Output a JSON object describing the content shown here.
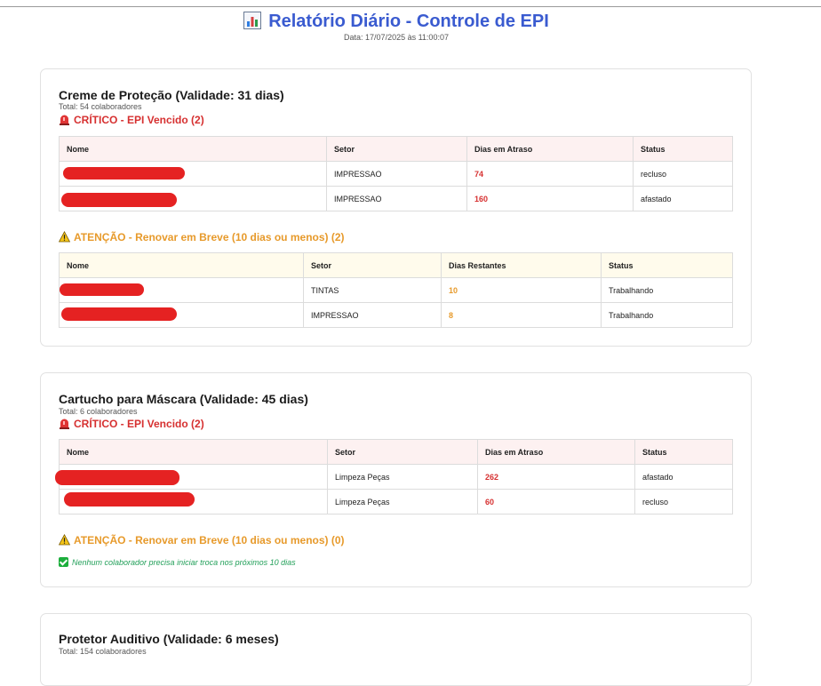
{
  "report": {
    "title": "Relatório Diário - Controle de EPI",
    "date": "Data: 17/07/2025 às 11:00:07",
    "icon": "bar-chart-icon"
  },
  "sections": [
    {
      "title": "Creme de Proteção (Validade: 31 dias)",
      "total": "Total: 54 colaboradores",
      "critical": {
        "label": "CRÍTICO - EPI Vencido (2)",
        "icon": "siren-icon",
        "headers": [
          "Nome",
          "Setor",
          "Dias em Atraso",
          "Status"
        ],
        "rows": [
          {
            "nome": "",
            "setor": "IMPRESSAO",
            "dias": "74",
            "status": "recluso"
          },
          {
            "nome": "",
            "setor": "IMPRESSAO",
            "dias": "160",
            "status": "afastado"
          }
        ]
      },
      "warning": {
        "label": "ATENÇÃO - Renovar em Breve (10 dias ou menos) (2)",
        "icon": "warning-icon",
        "headers": [
          "Nome",
          "Setor",
          "Dias Restantes",
          "Status"
        ],
        "rows": [
          {
            "nome": "",
            "setor": "TINTAS",
            "dias": "10",
            "status": "Trabalhando"
          },
          {
            "nome": "",
            "setor": "IMPRESSAO",
            "dias": "8",
            "status": "Trabalhando"
          }
        ]
      }
    },
    {
      "title": "Cartucho para Máscara (Validade: 45 dias)",
      "total": "Total: 6 colaboradores",
      "critical": {
        "label": "CRÍTICO - EPI Vencido (2)",
        "icon": "siren-icon",
        "headers": [
          "Nome",
          "Setor",
          "Dias em Atraso",
          "Status"
        ],
        "rows": [
          {
            "nome": "",
            "setor": "Limpeza Peças",
            "dias": "262",
            "status": "afastado"
          },
          {
            "nome": "",
            "setor": "Limpeza Peças",
            "dias": "60",
            "status": "recluso"
          }
        ]
      },
      "warning": {
        "label": "ATENÇÃO - Renovar em Breve (10 dias ou menos) (0)",
        "icon": "warning-icon",
        "empty_message": "Nenhum colaborador precisa iniciar troca nos próximos 10 dias"
      }
    },
    {
      "title": "Protetor Auditivo (Validade: 6 meses)",
      "total": "Total: 154 colaboradores"
    }
  ],
  "colors": {
    "title": "#3a5bd0",
    "critical": "#d63030",
    "warning": "#e79a2b",
    "ok": "#23a05a",
    "redaction": "#e52222"
  }
}
